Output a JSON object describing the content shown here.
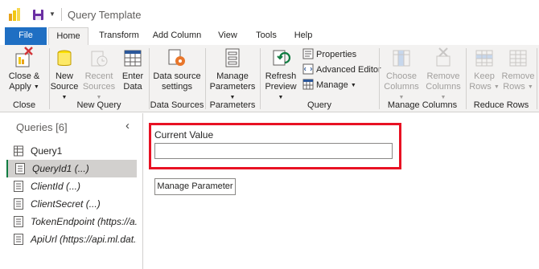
{
  "window": {
    "title": "Query Template"
  },
  "tabs": [
    {
      "label": "File"
    },
    {
      "label": "Home"
    },
    {
      "label": "Transform"
    },
    {
      "label": "Add Column"
    },
    {
      "label": "View"
    },
    {
      "label": "Tools"
    },
    {
      "label": "Help"
    }
  ],
  "ribbon": {
    "groups": {
      "close": {
        "label": "Close",
        "close_apply": {
          "line1": "Close &",
          "line2": "Apply"
        }
      },
      "new_query": {
        "label": "New Query",
        "new_source": {
          "line1": "New",
          "line2": "Source"
        },
        "recent_sources": {
          "line1": "Recent",
          "line2": "Sources"
        },
        "enter_data": {
          "line1": "Enter",
          "line2": "Data"
        }
      },
      "data_sources": {
        "label": "Data Sources",
        "data_source_settings": {
          "line1": "Data source",
          "line2": "settings"
        }
      },
      "parameters": {
        "label": "Parameters",
        "manage_parameters": {
          "line1": "Manage",
          "line2": "Parameters"
        }
      },
      "query": {
        "label": "Query",
        "refresh_preview": {
          "line1": "Refresh",
          "line2": "Preview"
        },
        "properties": "Properties",
        "advanced_editor": "Advanced Editor",
        "manage": "Manage"
      },
      "manage_columns": {
        "label": "Manage Columns",
        "choose_columns": {
          "line1": "Choose",
          "line2": "Columns"
        },
        "remove_columns": {
          "line1": "Remove",
          "line2": "Columns"
        }
      },
      "reduce_rows": {
        "label": "Reduce Rows",
        "keep_rows": {
          "line1": "Keep",
          "line2": "Rows"
        },
        "remove_rows": {
          "line1": "Remove",
          "line2": "Rows"
        }
      }
    }
  },
  "queries_pane": {
    "title": "Queries [6]",
    "items": [
      {
        "label": "Query1",
        "italic": false,
        "selected": false
      },
      {
        "label": "QueryId1 (...)",
        "italic": true,
        "selected": true
      },
      {
        "label": "ClientId (...)",
        "italic": true,
        "selected": false
      },
      {
        "label": "ClientSecret (...)",
        "italic": true,
        "selected": false
      },
      {
        "label": "TokenEndpoint (https://a...",
        "italic": true,
        "selected": false
      },
      {
        "label": "ApiUrl (https://api.ml.dat...",
        "italic": true,
        "selected": false
      }
    ]
  },
  "parameter_editor": {
    "current_value_label": "Current Value",
    "current_value": "",
    "manage_parameter_button": "Manage Parameter"
  },
  "colors": {
    "accent": "#1f6fc3",
    "highlight_box": "#e81123",
    "selected_row": "#d2d0ce",
    "selected_marker": "#107c41"
  }
}
